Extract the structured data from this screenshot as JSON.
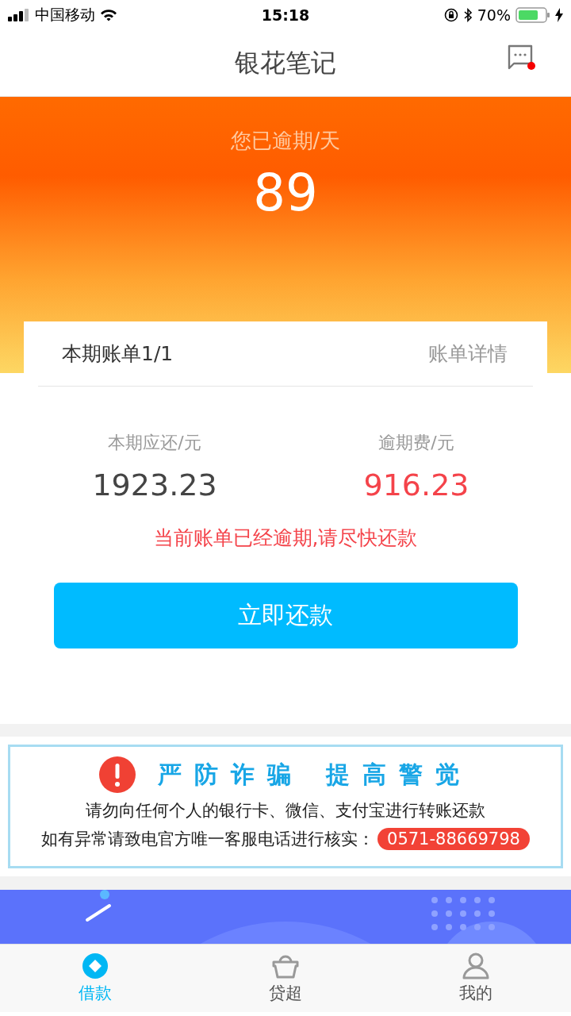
{
  "status_bar": {
    "carrier": "中国移动",
    "time": "15:18",
    "battery": "70%"
  },
  "nav": {
    "title": "银花笔记",
    "message_unread": true
  },
  "overdue": {
    "label": "您已逾期/天",
    "days": "89"
  },
  "bill": {
    "title": "本期账单1/1",
    "detail_link": "账单详情",
    "amounts": [
      {
        "label": "本期应还/元",
        "value": "1923.23",
        "kind": "normal"
      },
      {
        "label": "逾期费/元",
        "value": "916.23",
        "kind": "alert"
      }
    ],
    "warning": "当前账单已经逾期,请尽快还款",
    "button": "立即还款"
  },
  "notice": {
    "title_parts": [
      "严防诈骗",
      "提高警觉"
    ],
    "line_1": "请勿向任何个人的银行卡、微信、支付宝进行转账还款",
    "line_2": "如有异常请致电官方唯一客服电话进行核实：",
    "phone": "0571-88669798"
  },
  "tabs": [
    {
      "label": "借款",
      "selected": true,
      "kind": "loan"
    },
    {
      "label": "贷超",
      "selected": false,
      "kind": "basket"
    },
    {
      "label": "我的",
      "selected": false,
      "kind": "person"
    }
  ]
}
